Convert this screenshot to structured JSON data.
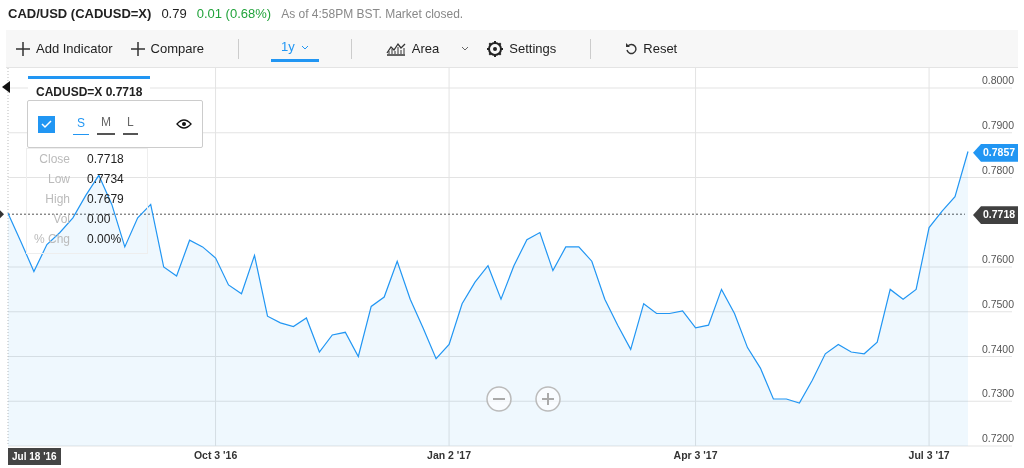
{
  "quote": {
    "title": "CAD/USD (CADUSD=X)",
    "price": "0.79",
    "change": "0.01 (0.68%)",
    "note": "As of 4:58PM BST. Market closed."
  },
  "toolbar": [
    {
      "kind": "plus",
      "label": "Add Indicator"
    },
    {
      "kind": "plus",
      "label": "Compare"
    },
    {
      "kind": "divider"
    },
    {
      "kind": "range",
      "label": "1y",
      "selected": true
    },
    {
      "kind": "divider"
    },
    {
      "kind": "charttype",
      "label": "Area"
    },
    {
      "kind": "gear",
      "label": "Settings"
    },
    {
      "kind": "divider"
    },
    {
      "kind": "reset",
      "label": "Reset"
    }
  ],
  "legend": {
    "label": "CADUSD=X 0.7718",
    "checked": true,
    "sizes": [
      {
        "label": "S",
        "selected": true
      },
      {
        "label": "M",
        "selected": false
      },
      {
        "label": "L",
        "selected": false
      }
    ]
  },
  "tooltip": [
    {
      "label": "Close",
      "value": "0.7718"
    },
    {
      "label": "Low",
      "value": "0.7734"
    },
    {
      "label": "High",
      "value": "0.7679"
    },
    {
      "label": "Vol",
      "value": "0.00"
    },
    {
      "label": "% Chg",
      "value": "0.00%"
    }
  ],
  "cursor_date": "Jul 18 '16",
  "price_tags": [
    {
      "value": "0.7857",
      "color": "#2196f3"
    },
    {
      "value": "0.7718",
      "color": "#404040"
    }
  ],
  "zoom_controls": [
    {
      "kind": "out"
    },
    {
      "kind": "in"
    }
  ],
  "chart_data": {
    "type": "area",
    "categories": [
      null,
      null,
      null,
      null,
      null,
      null,
      null,
      null,
      null,
      null,
      null,
      null,
      null,
      null,
      null,
      null,
      "Oct 3 '16",
      null,
      null,
      null,
      null,
      null,
      null,
      null,
      null,
      null,
      null,
      null,
      null,
      null,
      null,
      null,
      null,
      null,
      "Jan 2 '17",
      null,
      null,
      null,
      null,
      null,
      null,
      null,
      null,
      null,
      null,
      null,
      null,
      null,
      null,
      null,
      null,
      null,
      null,
      "Apr 3 '17",
      null,
      null,
      null,
      null,
      null,
      null,
      null,
      null,
      null,
      null,
      null,
      null,
      null,
      null,
      null,
      null,
      null,
      "Jul 3 '17",
      null,
      null,
      null
    ],
    "series": [
      {
        "color": "#2196f3",
        "values": [
          0.772,
          0.7656,
          0.759,
          0.765,
          0.7677,
          0.771,
          0.776,
          0.7805,
          0.774,
          0.7645,
          0.771,
          0.774,
          0.76,
          0.758,
          0.766,
          0.7645,
          0.762,
          0.756,
          0.754,
          0.7626,
          0.749,
          0.7475,
          0.7467,
          0.7486,
          0.741,
          0.7448,
          0.7454,
          0.74,
          0.7512,
          0.7533,
          0.7613,
          0.7528,
          0.7464,
          0.7395,
          0.7427,
          0.7518,
          0.7566,
          0.7603,
          0.7528,
          0.7603,
          0.7661,
          0.7677,
          0.7592,
          0.7645,
          0.7645,
          0.7613,
          0.7528,
          0.747,
          0.7416,
          0.7518,
          0.7496,
          0.7496,
          0.7502,
          0.7464,
          0.747,
          0.755,
          0.7496,
          0.742,
          0.7374,
          0.7305,
          0.7305,
          0.7296,
          0.7347,
          0.7406,
          0.7427,
          0.741,
          0.7406,
          0.7432,
          0.755,
          0.7528,
          0.755,
          0.7688,
          0.7725,
          0.7757,
          0.7858
        ]
      }
    ],
    "grid": true,
    "ref_lines": [
      {
        "axis": "y",
        "value": 0.7718
      }
    ],
    "ylim": [
      0.72,
      0.8
    ],
    "yticks": [
      {
        "value": 0.8,
        "label": "0.8000"
      },
      {
        "value": 0.79,
        "label": "0.7900"
      },
      {
        "value": 0.78,
        "label": "0.7800"
      },
      {
        "value": 0.76,
        "label": "0.7600"
      },
      {
        "value": 0.75,
        "label": "0.7500"
      },
      {
        "value": 0.74,
        "label": "0.7400"
      },
      {
        "value": 0.73,
        "label": "0.7300"
      },
      {
        "value": 0.72,
        "label": "0.7200"
      }
    ]
  }
}
